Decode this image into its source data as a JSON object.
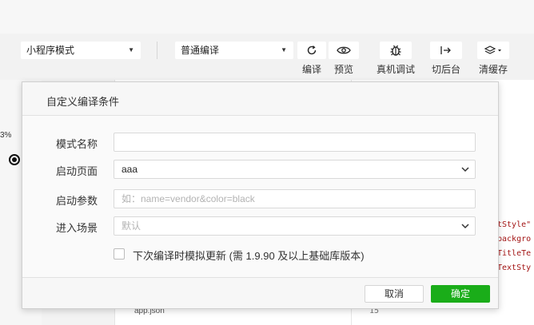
{
  "toolbar": {
    "mode_select": "小程序模式",
    "compile_select": "普通编译",
    "buttons": [
      {
        "label": "编译",
        "icon": "refresh-icon"
      },
      {
        "label": "预览",
        "icon": "eye-icon"
      },
      {
        "label": "真机调试",
        "icon": "bug-icon"
      },
      {
        "label": "切后台",
        "icon": "switch-background-icon"
      },
      {
        "label": "清缓存",
        "icon": "layers-icon"
      }
    ]
  },
  "background": {
    "percent_text": "3%",
    "code_lines": [
      "tStyle\"",
      "backgro",
      "TitleTe",
      "TextSty"
    ],
    "file_name": "app.json",
    "line_number": "15"
  },
  "dialog": {
    "title": "自定义编译条件",
    "fields": {
      "mode_name": {
        "label": "模式名称",
        "value": ""
      },
      "start_page": {
        "label": "启动页面",
        "value": "aaa"
      },
      "start_params": {
        "label": "启动参数",
        "placeholder": "如：name=vendor&color=black"
      },
      "scene": {
        "label": "进入场景",
        "placeholder": "默认"
      }
    },
    "checkbox_label": "下次编译时模拟更新 (需 1.9.90 及以上基础库版本)",
    "cancel_label": "取消",
    "confirm_label": "确定"
  },
  "colors": {
    "primary_green": "#1aad19"
  }
}
